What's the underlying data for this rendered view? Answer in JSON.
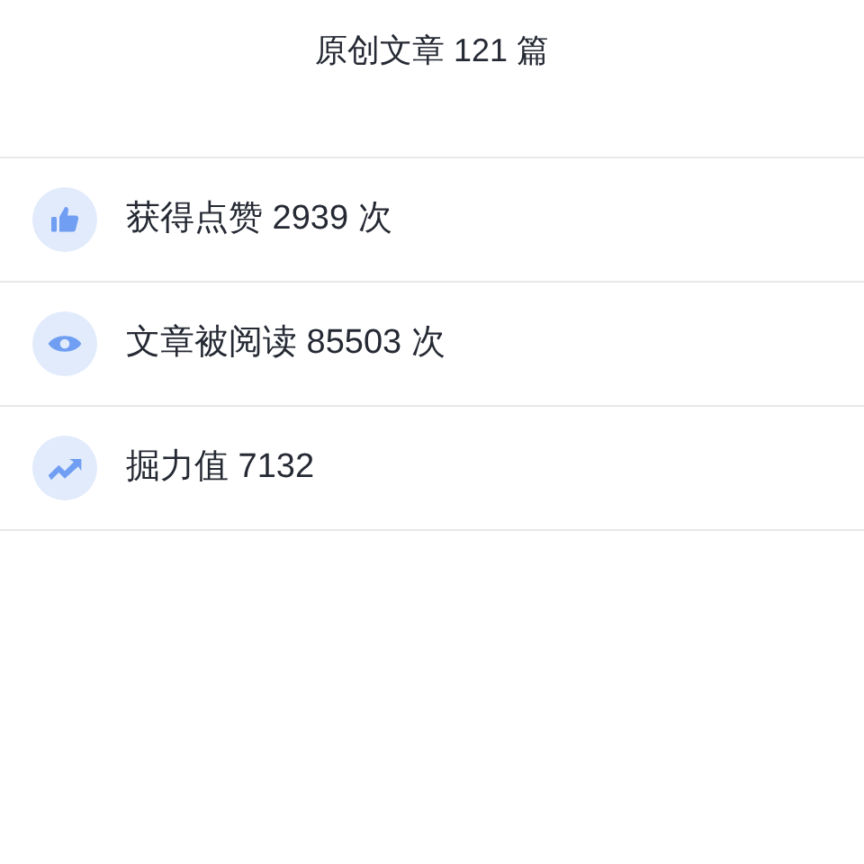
{
  "header": {
    "title": "原创文章 121 篇"
  },
  "stats": [
    {
      "kind": "like",
      "text": "获得点赞 2939 次"
    },
    {
      "kind": "view",
      "text": "文章被阅读 85503 次"
    },
    {
      "kind": "trend",
      "text": "掘力值 7132"
    }
  ]
}
